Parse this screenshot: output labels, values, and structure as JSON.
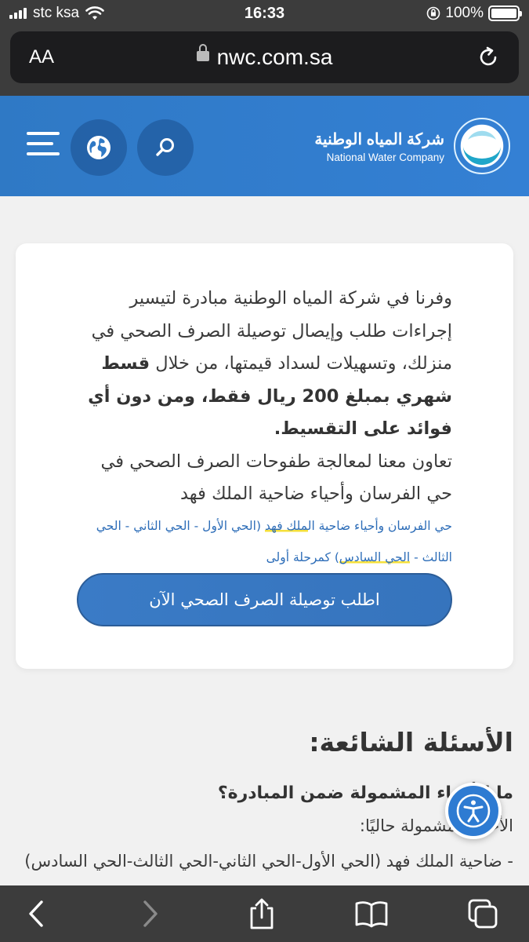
{
  "status_bar": {
    "carrier": "stc ksa",
    "time": "16:33",
    "battery": "100%"
  },
  "browser": {
    "text_size_label": "AA",
    "url": "nwc.com.sa"
  },
  "header": {
    "logo_ar": "شركة المياه الوطنية",
    "logo_en": "National Water Company",
    "icons": [
      "menu-icon",
      "globe-icon",
      "search-icon"
    ]
  },
  "card": {
    "intro": "وفرنا في شركة المياه الوطنية مبادرة لتيسير إجراءات طلب وإيصال توصيلة الصرف الصحي في منزلك، وتسهيلات لسداد قيمتها، من خلال",
    "bold": "قسط شهري بمبلغ 200 ريال فقط، ومن دون أي فوائد على التقسيط.",
    "body2": "تعاون معنا لمعالجة طفوحات الصرف الصحي في حي الفرسان وأحياء ضاحية الملك فهد",
    "note_1": "حي الفرسان وأحياء ضاحية ال",
    "note_2": "ملك فهد",
    "note_3": " (الحي الأول - الحي الثاني - الحي الثالث - ",
    "note_4": "الحي السادس",
    "note_5": ") كمرحلة أولى",
    "cta": "اطلب توصيلة الصرف الصحي الآن"
  },
  "faq": {
    "title": "الأسئلة الشائعة:",
    "question": "ما الأحياء المشمولة ضمن المبادرة؟",
    "answer_1": "الأحياء المشمولة حاليًا:",
    "answer_2": "- ضاحية الملك فهد (الحي الأول-الحي الثاني-الحي الثالث-الحي السادس)"
  },
  "accessibility_button": "accessibility-icon",
  "toolbar": {
    "icons": [
      "back-icon",
      "forward-icon",
      "share-icon",
      "bookmarks-icon",
      "tabs-icon"
    ]
  }
}
